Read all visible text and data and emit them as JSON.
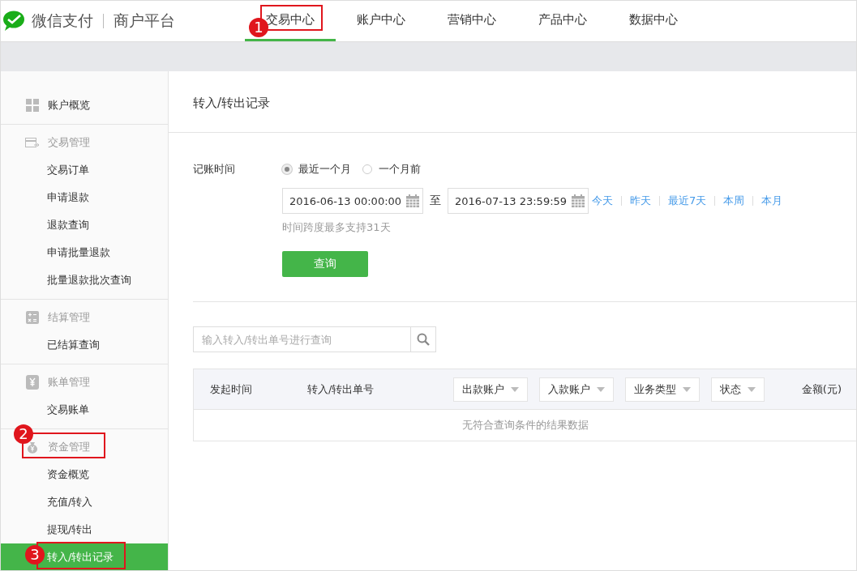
{
  "header": {
    "brand": "微信支付",
    "platform": "商户平台",
    "nav_tabs": [
      {
        "label": "交易中心",
        "selected": true
      },
      {
        "label": "账户中心",
        "selected": false
      },
      {
        "label": "营销中心",
        "selected": false
      },
      {
        "label": "产品中心",
        "selected": false
      },
      {
        "label": "数据中心",
        "selected": false
      }
    ]
  },
  "sidebar": {
    "groups": [
      {
        "kind": "link",
        "label": "账户概览"
      },
      {
        "kind": "section",
        "label": "交易管理",
        "children": [
          {
            "label": "交易订单",
            "selected": false
          },
          {
            "label": "申请退款",
            "selected": false
          },
          {
            "label": "退款查询",
            "selected": false
          },
          {
            "label": "申请批量退款",
            "selected": false
          },
          {
            "label": "批量退款批次查询",
            "selected": false
          }
        ]
      },
      {
        "kind": "section",
        "label": "结算管理",
        "children": [
          {
            "label": "已结算查询",
            "selected": false
          }
        ]
      },
      {
        "kind": "section",
        "label": "账单管理",
        "children": [
          {
            "label": "交易账单",
            "selected": false
          }
        ]
      },
      {
        "kind": "section",
        "label": "资金管理",
        "children": [
          {
            "label": "资金概览",
            "selected": false
          },
          {
            "label": "充值/转入",
            "selected": false
          },
          {
            "label": "提现/转出",
            "selected": false
          },
          {
            "label": "转入/转出记录",
            "selected": true
          }
        ]
      }
    ]
  },
  "page_title": "转入/转出记录",
  "filter": {
    "label": "记账时间",
    "radios": [
      {
        "label": "最近一个月",
        "selected": true
      },
      {
        "label": "一个月前",
        "selected": false
      }
    ],
    "start": "2016-06-13 00:00:00",
    "separator": "至",
    "end": "2016-07-13 23:59:59",
    "quick_links": [
      "今天",
      "昨天",
      "最近7天",
      "本周",
      "本月"
    ],
    "hint": "时间跨度最多支持31天",
    "button": "查询"
  },
  "search": {
    "placeholder": "输入转入/转出单号进行查询"
  },
  "table": {
    "columns": [
      {
        "kind": "text",
        "label": "发起时间"
      },
      {
        "kind": "text",
        "label": "转入/转出单号"
      },
      {
        "kind": "filter",
        "label": "出款账户"
      },
      {
        "kind": "filter",
        "label": "入款账户"
      },
      {
        "kind": "filter",
        "label": "业务类型"
      },
      {
        "kind": "filter",
        "label": "状态"
      },
      {
        "kind": "amount",
        "label": "金额(元)"
      }
    ],
    "empty_message": "无符合查询条件的结果数据"
  },
  "annotations": [
    {
      "number": "1"
    },
    {
      "number": "2"
    },
    {
      "number": "3"
    }
  ]
}
